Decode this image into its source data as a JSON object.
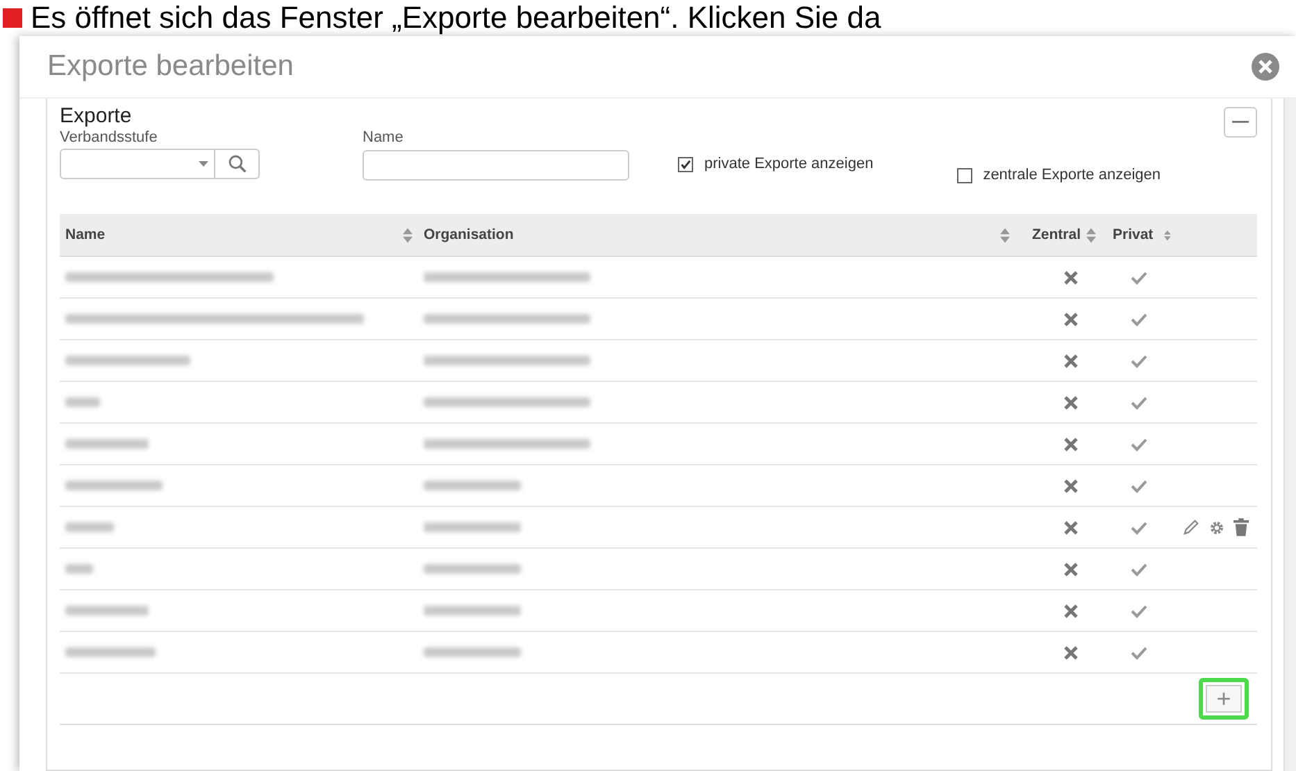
{
  "caption": "Es öffnet sich das Fenster „Exporte bearbeiten“. Klicken Sie da",
  "window": {
    "title": "Exporte bearbeiten"
  },
  "panel": {
    "title": "Exporte"
  },
  "filters": {
    "level_label": "Verbandsstufe",
    "name_label": "Name",
    "private_label": "private Exporte anzeigen",
    "private_checked": true,
    "central_label": "zentrale Exporte anzeigen",
    "central_checked": false
  },
  "table": {
    "columns": [
      "Name",
      "Organisation",
      "Zentral",
      "Privat"
    ],
    "rows": [
      {
        "zentral": false,
        "privat": true,
        "actions": false
      },
      {
        "zentral": false,
        "privat": true,
        "actions": false
      },
      {
        "zentral": false,
        "privat": true,
        "actions": false
      },
      {
        "zentral": false,
        "privat": true,
        "actions": false
      },
      {
        "zentral": false,
        "privat": true,
        "actions": false
      },
      {
        "zentral": false,
        "privat": true,
        "actions": false
      },
      {
        "zentral": false,
        "privat": true,
        "actions": true
      },
      {
        "zentral": false,
        "privat": true,
        "actions": false
      },
      {
        "zentral": false,
        "privat": true,
        "actions": false
      },
      {
        "zentral": false,
        "privat": true,
        "actions": false
      }
    ]
  },
  "add_button": {
    "label": "+",
    "highlighted": true
  }
}
